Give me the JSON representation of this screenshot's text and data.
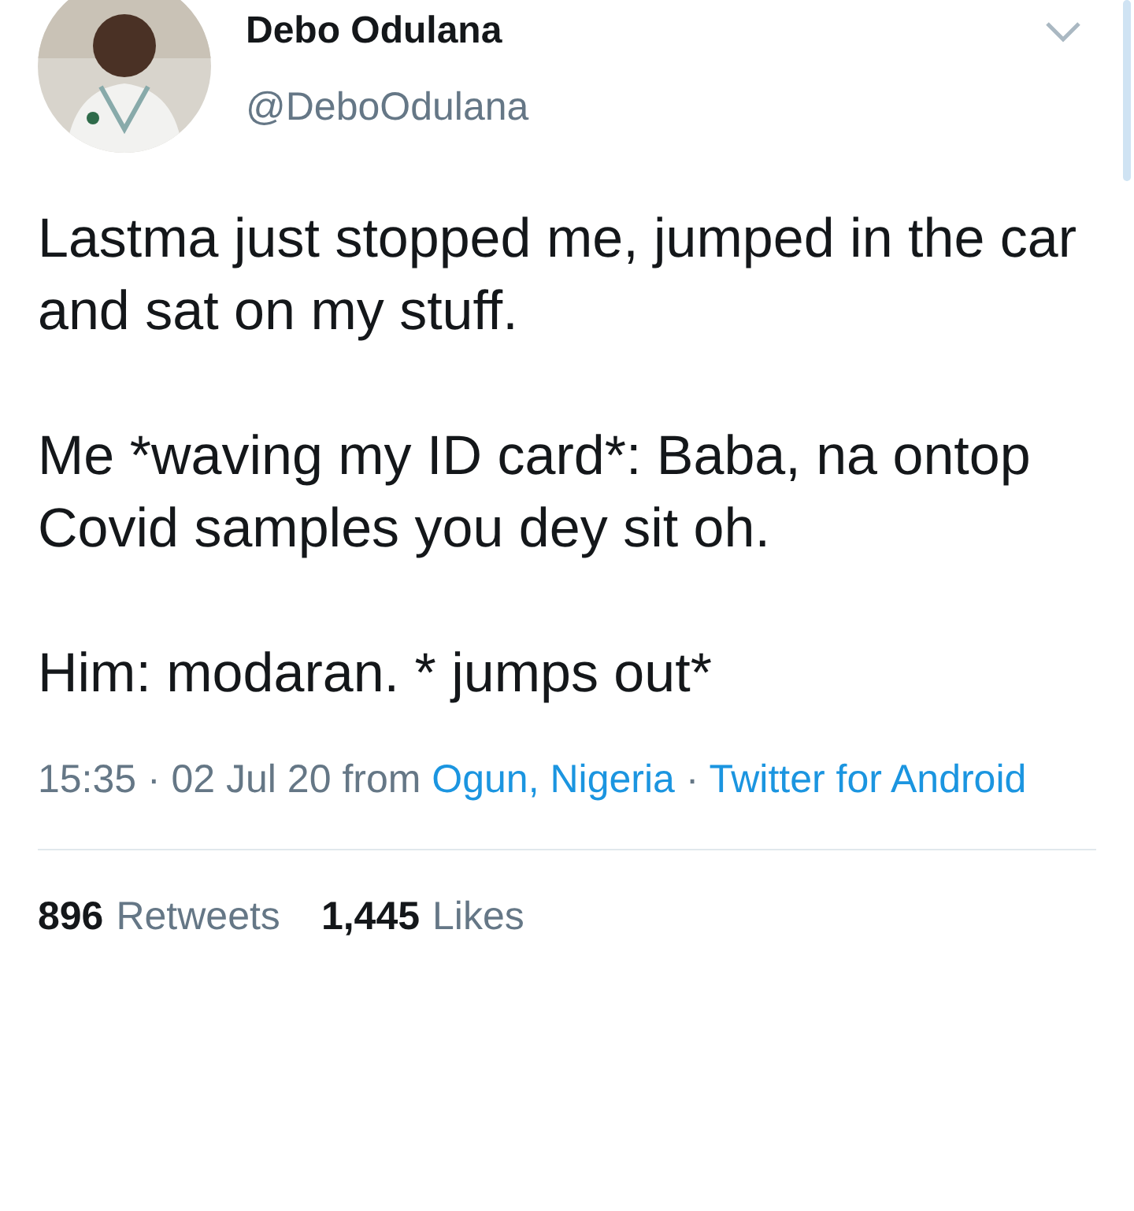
{
  "author": {
    "name": "Debo Odulana",
    "handle": "@DeboOdulana"
  },
  "tweet": {
    "paragraphs": [
      "Lastma just stopped me, jumped in the car and sat on my stuff.",
      "Me *waving my ID card*: Baba, na ontop Covid samples you dey sit oh.",
      "Him: modaran. * jumps out*"
    ]
  },
  "meta": {
    "time": "15:35 · 02 Jul 20 from",
    "location": "Ogun, Nigeria",
    "separator": "·",
    "source": "Twitter for Android"
  },
  "stats": [
    {
      "count": "896",
      "label": "Retweets"
    },
    {
      "count": "1,445",
      "label": "Likes"
    }
  ]
}
